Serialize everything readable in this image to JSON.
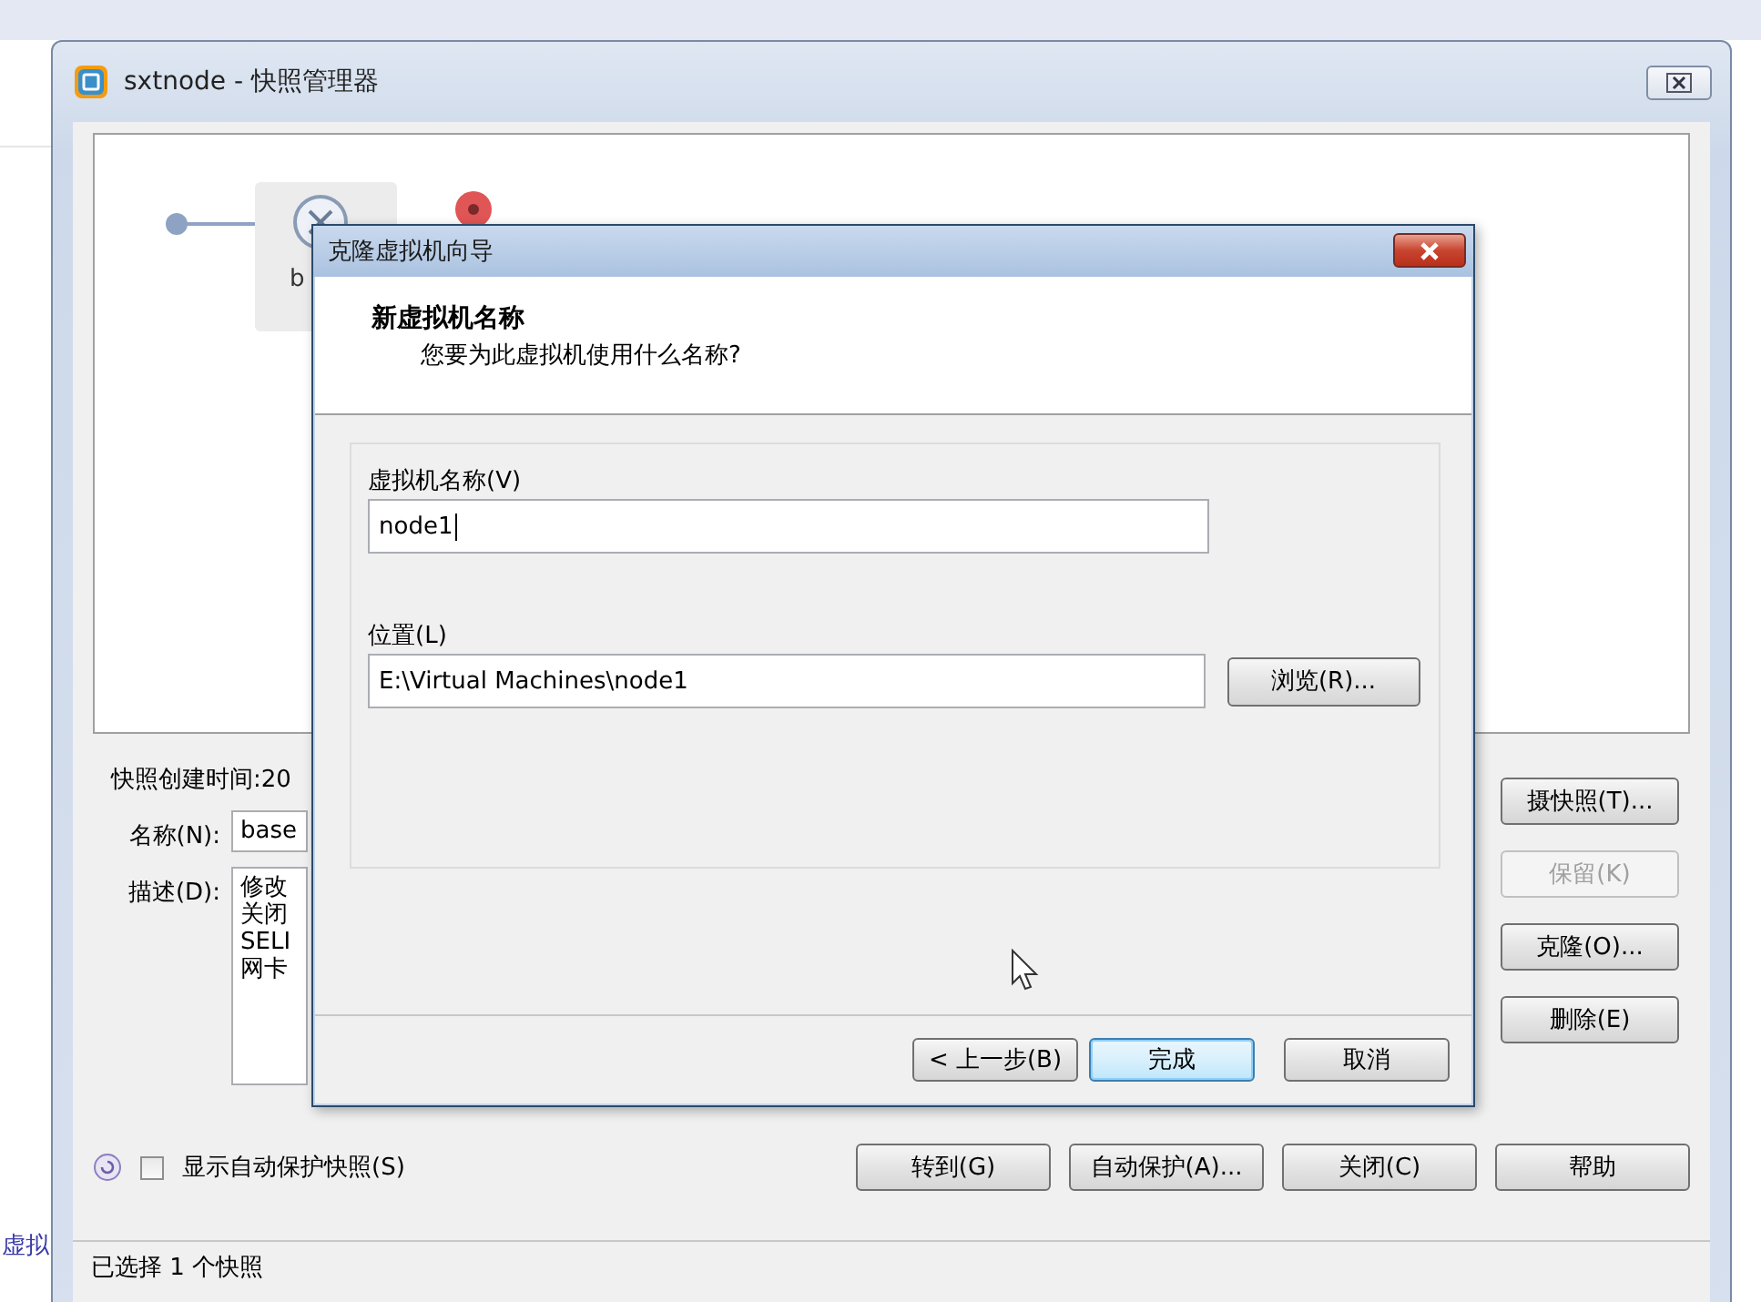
{
  "background_text": "虚拟",
  "manager": {
    "title": "sxtnode - 快照管理器",
    "tree": {
      "snapshots": [
        {
          "label": "b",
          "selected": true
        }
      ]
    },
    "details": {
      "created_label": "快照创建时间:20",
      "name_label": "名称(N):",
      "name_value": "base",
      "description_label": "描述(D):",
      "description_lines": [
        "修改",
        "关闭",
        "SELI",
        "网卡"
      ]
    },
    "side_buttons": [
      {
        "label": "摄快照(T)...",
        "disabled": false
      },
      {
        "label": "保留(K)",
        "disabled": true
      },
      {
        "label": "克隆(O)...",
        "disabled": false
      },
      {
        "label": "删除(E)",
        "disabled": false
      }
    ],
    "show_auto_checkbox": {
      "label": "显示自动保护快照(S)",
      "checked": false
    },
    "buttons": [
      "转到(G)",
      "自动保护(A)...",
      "关闭(C)",
      "帮助"
    ],
    "status_bar": "已选择 1 个快照"
  },
  "dialog": {
    "title": "克隆虚拟机向导",
    "heading": "新虚拟机名称",
    "subheading": "您要为此虚拟机使用什么名称?",
    "fields": [
      {
        "label": "虚拟机名称(V)",
        "value": "node1"
      },
      {
        "label": "位置(L)",
        "value": "E:\\Virtual Machines\\node1",
        "button": "浏览(R)..."
      }
    ],
    "buttons": [
      {
        "label": "< 上一步(B)",
        "default": false
      },
      {
        "label": "完成",
        "default": true
      },
      {
        "label": "取消",
        "default": false
      }
    ]
  }
}
